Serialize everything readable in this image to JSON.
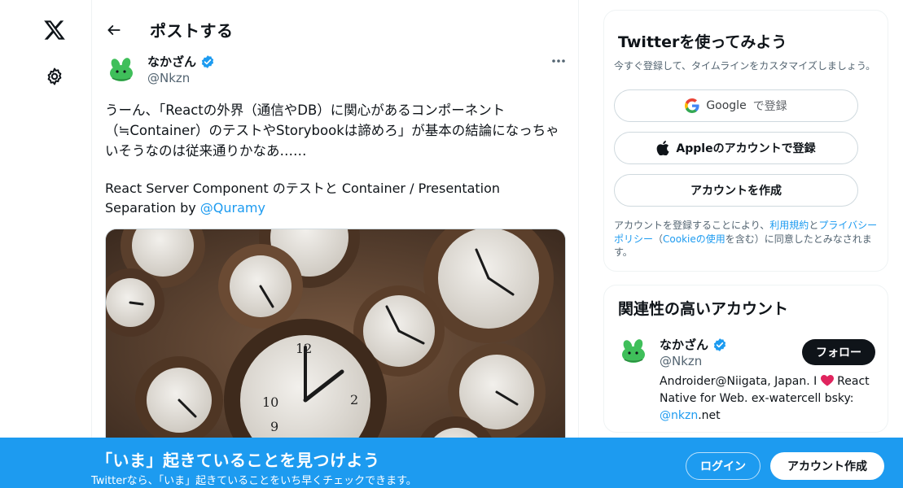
{
  "nav": {
    "logo_icon": "x-logo-icon",
    "settings_icon": "gear-icon"
  },
  "header": {
    "title": "ポストする",
    "back_icon": "arrow-left-icon"
  },
  "post": {
    "author_name": "なかざん",
    "author_handle": "@Nkzn",
    "text_main": "うーん、「Reactの外界（通信やDB）に関心があるコンポーネント（≒Container）のテストやStorybookは諦めろ」が基本の結論になっちゃいそうなのは従来通りかなあ……",
    "text_link_prefix": "React Server Component のテストと Container / Presentation Separation by ",
    "mention": "@Quramy",
    "more_icon": "more-dots-icon",
    "media_description_icon": "clocks-photo"
  },
  "signup": {
    "title": "Twitterを使ってみよう",
    "subtitle": "今すぐ登録して、タイムラインをカスタマイズしましょう。",
    "google_label": "Google",
    "google_suffix": "で登録",
    "apple_label": "Appleのアカウントで登録",
    "create_label": "アカウントを作成",
    "terms_prefix": "アカウントを登録することにより、",
    "terms_link": "利用規約",
    "terms_and": "と",
    "privacy_link": "プライバシーポリシー",
    "terms_paren_open": "（",
    "cookie_link": "Cookieの使用",
    "terms_suffix": "を含む）に同意したとみなされます。"
  },
  "related": {
    "title": "関連性の高いアカウント",
    "name": "なかざん",
    "handle": "@Nkzn",
    "follow_label": "フォロー",
    "bio_before_heart": "Androider@Niigata, Japan. I",
    "bio_after_heart": "React Native for Web. ex-watercell bsky:",
    "bio_link": "@nkzn",
    "bio_end": ".net"
  },
  "banner": {
    "title": "「いま」起きていることを見つけよう",
    "subtitle": "Twitterなら、「いま」起きていることをいち早くチェックできます。",
    "login_label": "ログイン",
    "create_label": "アカウント作成"
  },
  "colors": {
    "accent": "#1d9bf0",
    "text": "#0f1419",
    "muted": "#536471"
  }
}
